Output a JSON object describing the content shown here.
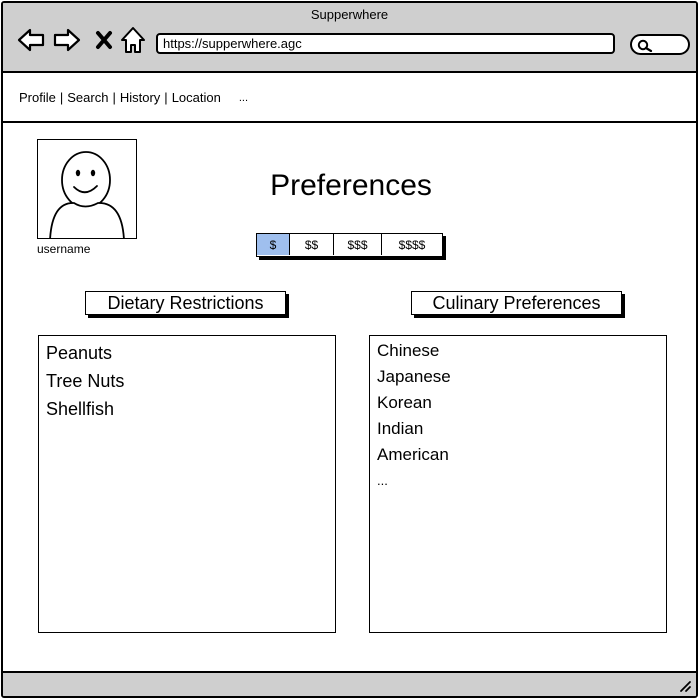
{
  "window": {
    "title": "Supperwhere"
  },
  "toolbar": {
    "back_icon": "arrow-left-icon",
    "forward_icon": "arrow-right-icon",
    "stop_icon": "close-x-icon",
    "home_icon": "home-icon",
    "url": "https://supperwhere.agc",
    "search_icon": "search-icon"
  },
  "menu": {
    "items": [
      "Profile",
      "Search",
      "History",
      "Location"
    ],
    "separator": "|",
    "more": "..."
  },
  "profile": {
    "username": "username"
  },
  "page": {
    "title": "Preferences"
  },
  "price": {
    "options": [
      "$",
      "$$",
      "$$$",
      "$$$$"
    ],
    "selected": "$",
    "accent_color": "#9fbfee"
  },
  "dietary": {
    "label": "Dietary Restrictions",
    "items": [
      "Peanuts",
      "Tree Nuts",
      "Shellfish"
    ]
  },
  "culinary": {
    "label": "Culinary Preferences",
    "items": [
      "Chinese",
      "Japanese",
      "Korean",
      "Indian",
      "American"
    ],
    "more": "..."
  },
  "colors": {
    "chrome": "#cfcfcf",
    "border": "#000000"
  }
}
